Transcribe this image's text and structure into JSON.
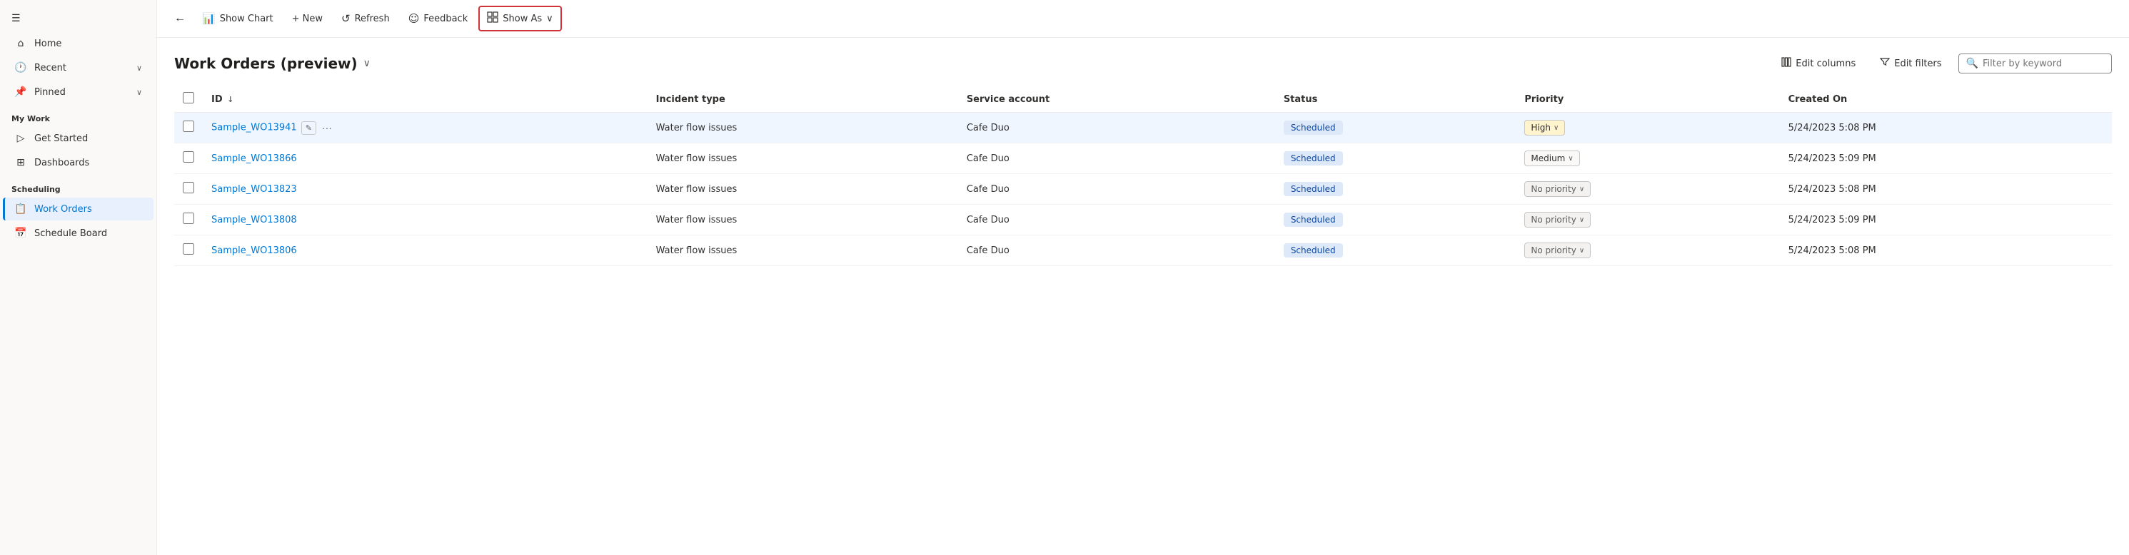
{
  "sidebar": {
    "hamburger_icon": "☰",
    "items": [
      {
        "id": "home",
        "label": "Home",
        "icon": "⌂",
        "active": false
      },
      {
        "id": "recent",
        "label": "Recent",
        "icon": "🕐",
        "chevron": "∨",
        "active": false
      },
      {
        "id": "pinned",
        "label": "Pinned",
        "icon": "📌",
        "chevron": "∨",
        "active": false
      }
    ],
    "mywork_header": "My Work",
    "mywork_items": [
      {
        "id": "get-started",
        "label": "Get Started",
        "icon": "▷",
        "active": false
      },
      {
        "id": "dashboards",
        "label": "Dashboards",
        "icon": "⊞",
        "active": false
      }
    ],
    "scheduling_header": "Scheduling",
    "scheduling_items": [
      {
        "id": "work-orders",
        "label": "Work Orders",
        "icon": "📋",
        "active": true
      },
      {
        "id": "schedule-board",
        "label": "Schedule Board",
        "icon": "📅",
        "active": false
      }
    ]
  },
  "toolbar": {
    "back_label": "←",
    "show_chart_label": "Show Chart",
    "new_label": "+ New",
    "refresh_label": "Refresh",
    "feedback_label": "Feedback",
    "show_as_label": "Show As",
    "show_as_chevron": "∨"
  },
  "page": {
    "title": "Work Orders (preview)",
    "title_chevron": "∨",
    "edit_columns_label": "Edit columns",
    "edit_filters_label": "Edit filters",
    "filter_placeholder": "Filter by keyword"
  },
  "table": {
    "columns": [
      {
        "id": "id",
        "label": "ID",
        "sort": "↓"
      },
      {
        "id": "incident_type",
        "label": "Incident type"
      },
      {
        "id": "service_account",
        "label": "Service account"
      },
      {
        "id": "status",
        "label": "Status"
      },
      {
        "id": "priority",
        "label": "Priority"
      },
      {
        "id": "created_on",
        "label": "Created On"
      }
    ],
    "rows": [
      {
        "id": "Sample_WO13941",
        "incident_type": "Water flow issues",
        "service_account": "Cafe Duo",
        "status": "Scheduled",
        "priority": "High",
        "priority_class": "priority-high",
        "created_on": "5/24/2023 5:08 PM",
        "active": true
      },
      {
        "id": "Sample_WO13866",
        "incident_type": "Water flow issues",
        "service_account": "Cafe Duo",
        "status": "Scheduled",
        "priority": "Medium",
        "priority_class": "priority-medium",
        "created_on": "5/24/2023 5:09 PM",
        "active": false
      },
      {
        "id": "Sample_WO13823",
        "incident_type": "Water flow issues",
        "service_account": "Cafe Duo",
        "status": "Scheduled",
        "priority": "No priority",
        "priority_class": "priority-none",
        "created_on": "5/24/2023 5:08 PM",
        "active": false
      },
      {
        "id": "Sample_WO13808",
        "incident_type": "Water flow issues",
        "service_account": "Cafe Duo",
        "status": "Scheduled",
        "priority": "No priority",
        "priority_class": "priority-none",
        "created_on": "5/24/2023 5:09 PM",
        "active": false
      },
      {
        "id": "Sample_WO13806",
        "incident_type": "Water flow issues",
        "service_account": "Cafe Duo",
        "status": "Scheduled",
        "priority": "No priority",
        "priority_class": "priority-none",
        "created_on": "5/24/2023 5:08 PM",
        "active": false
      }
    ]
  }
}
